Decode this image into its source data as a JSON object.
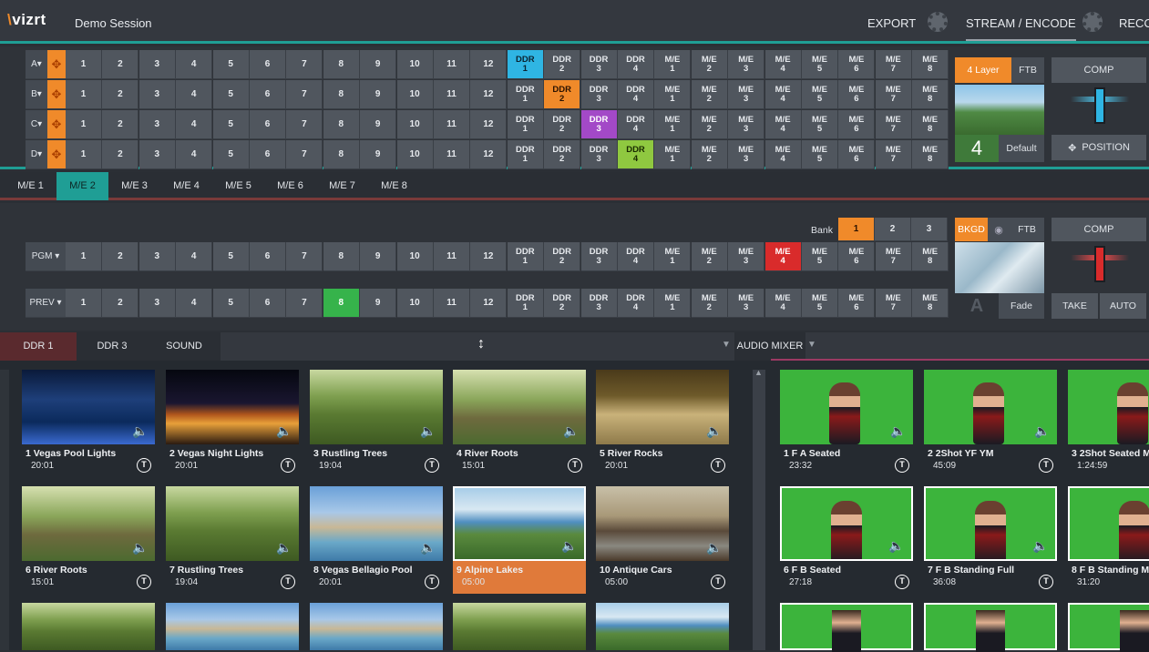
{
  "app": {
    "logo": "vizrt",
    "logo_mark": "\\",
    "session": "Demo Session"
  },
  "topbar": {
    "export": "EXPORT",
    "stream": "STREAM / ENCODE",
    "record": "RECO"
  },
  "switcher_buttons": [
    "1",
    "2",
    "3",
    "4",
    "5",
    "6",
    "7",
    "8",
    "9",
    "10",
    "11",
    "12",
    "DDR\n1",
    "DDR\n2",
    "DDR\n3",
    "DDR\n4",
    "M/E\n1",
    "M/E\n2",
    "M/E\n3",
    "M/E\n4",
    "M/E\n5",
    "M/E\n6",
    "M/E\n7",
    "M/E\n8"
  ],
  "me_rows": [
    {
      "label": "A▾",
      "selected": 12,
      "color": "sel-blue"
    },
    {
      "label": "B▾",
      "selected": 13,
      "color": "sel-orange"
    },
    {
      "label": "C▾",
      "selected": 14,
      "color": "sel-purple"
    },
    {
      "label": "D▾",
      "selected": 15,
      "color": "sel-lime"
    }
  ],
  "me_side": {
    "layer": "4 Layer",
    "ftb": "FTB",
    "number": "4",
    "default": "Default",
    "comp": "COMP",
    "position": "POSITION"
  },
  "me_tabs": [
    "M/E 1",
    "M/E 2",
    "M/E 3",
    "M/E 4",
    "M/E 5",
    "M/E 6",
    "M/E 7",
    "M/E 8"
  ],
  "me_tab_active": 1,
  "main_switcher": {
    "bank_label": "Bank",
    "banks": [
      "1",
      "2",
      "3"
    ],
    "bank_active": 0,
    "rows": [
      {
        "label": "PGM ▾",
        "selected": 19,
        "color": "sel-red"
      },
      {
        "label": "PREV ▾",
        "selected": 7,
        "color": "sel-green"
      }
    ],
    "bkgd": "BKGD",
    "ftb": "FTB",
    "fade": "Fade",
    "comp": "COMP",
    "take": "TAKE",
    "auto": "AUTO"
  },
  "bottom_tabs": {
    "ddr1": "DDR 1",
    "ddr3": "DDR 3",
    "sound": "SOUND",
    "audio_mixer": "AUDIO MIXER"
  },
  "media_left": [
    {
      "name": "1 Vegas Pool Lights",
      "dur": "20:01",
      "theme": "night"
    },
    {
      "name": "2 Vegas Night Lights",
      "dur": "20:01",
      "theme": "city"
    },
    {
      "name": "3 Rustling Trees",
      "dur": "19:04",
      "theme": "forest"
    },
    {
      "name": "4 River Roots",
      "dur": "15:01",
      "theme": "forest2"
    },
    {
      "name": "5 River Rocks",
      "dur": "20:01",
      "theme": "rocks"
    },
    {
      "name": "6 River Roots",
      "dur": "15:01",
      "theme": "forest2"
    },
    {
      "name": "7 Rustling Trees",
      "dur": "19:04",
      "theme": "forest"
    },
    {
      "name": "8 Vegas Bellagio Pool",
      "dur": "20:01",
      "theme": "bellagio"
    },
    {
      "name": "9 Alpine Lakes",
      "dur": "05:00",
      "theme": "alpine",
      "selected": true
    },
    {
      "name": "10 Antique Cars",
      "dur": "05:00",
      "theme": "cars"
    }
  ],
  "media_right": [
    {
      "name": "1 F A Seated",
      "dur": "23:32"
    },
    {
      "name": "2 2Shot YF YM",
      "dur": "45:09"
    },
    {
      "name": "3 2Shot Seated M",
      "dur": "1:24:59"
    },
    {
      "name": "6 F B Seated",
      "dur": "27:18"
    },
    {
      "name": "7 F B Standing Full",
      "dur": "36:08"
    },
    {
      "name": "8 F B Standing M",
      "dur": "31:20"
    }
  ],
  "t_badge": "T",
  "colors": {
    "accent": "#1f9e95",
    "orange": "#f08a2a",
    "blue": "#2fb5e3",
    "purple": "#a349c7",
    "lime": "#8fc840",
    "red": "#d92b2b",
    "green": "#36b34b"
  }
}
